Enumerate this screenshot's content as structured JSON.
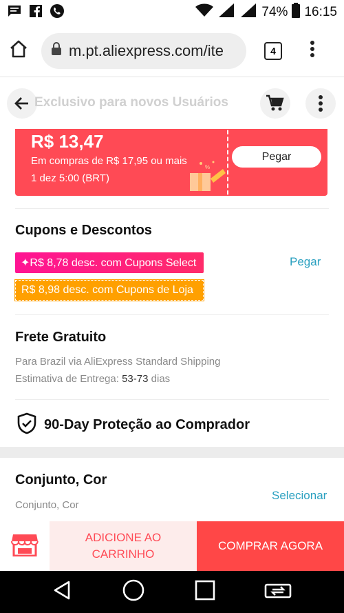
{
  "status": {
    "battery": "74%",
    "time": "16:15",
    "signal_1": "2G",
    "signal_2": "4G"
  },
  "browser": {
    "url": "m.pt.aliexpress.com/ite",
    "tab_count": "4"
  },
  "page_header": {
    "title": "Exclusivo para novos Usuários"
  },
  "coupon": {
    "amount": "R$ 13,47",
    "description": "Em compras de R$ 17,95 ou mais",
    "date": "1 dez 5:00 (BRT)",
    "button": "Pegar"
  },
  "discounts": {
    "title": "Cupons e Descontos",
    "select_tag": "✦R$ 8,78 desc. com Cupons Select",
    "store_tag": "R$ 8,98 desc. com Cupons de Loja",
    "action": "Pegar"
  },
  "shipping": {
    "title": "Frete Gratuito",
    "line1": "Para Brazil via AliExpress Standard Shipping",
    "estimate_label": "Estimativa de Entrega:",
    "estimate_value": "53-73",
    "estimate_unit": "dias"
  },
  "protection": {
    "title": "90-Day Proteção ao Comprador"
  },
  "variant": {
    "title": "Conjunto, Cor",
    "subtitle": "Conjunto, Cor",
    "action": "Selecionar"
  },
  "actions": {
    "add_to_cart_line1": "ADICIONE AO",
    "add_to_cart_line2": "CARRINHO",
    "buy_now": "COMPRAR AGORA"
  },
  "colors": {
    "accent_red": "#ff4a55",
    "select_pink": "#ff1493",
    "store_orange": "#ffa000",
    "link_blue": "#2aa0c0"
  },
  "icons": [
    "message-icon",
    "facebook-icon",
    "phone-icon",
    "wifi-icon",
    "signal-icon",
    "battery-icon",
    "home-icon",
    "lock-icon",
    "tab-switcher-icon",
    "menu-dots-icon",
    "back-arrow-icon",
    "cart-icon",
    "more-icon",
    "gift-icon",
    "shield-icon",
    "store-icon",
    "nav-back-icon",
    "nav-home-icon",
    "nav-recents-icon",
    "nav-switch-icon"
  ]
}
